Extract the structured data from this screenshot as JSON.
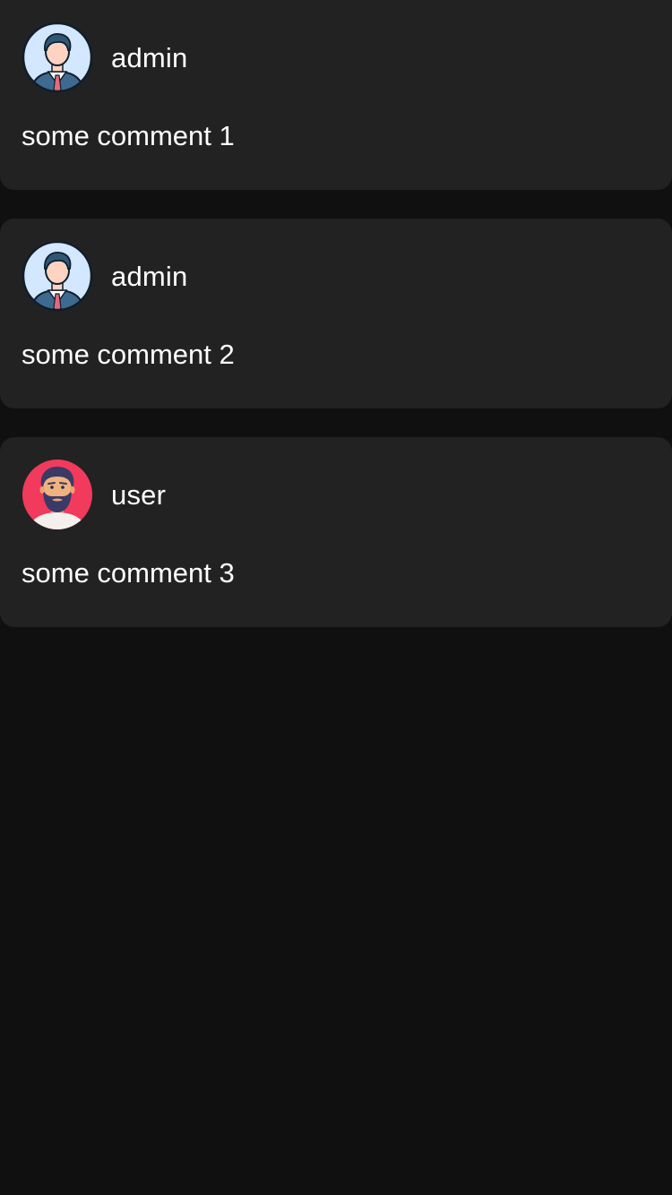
{
  "comments": [
    {
      "author": "admin",
      "avatar_icon": "admin-avatar-icon",
      "text": "some comment 1"
    },
    {
      "author": "admin",
      "avatar_icon": "admin-avatar-icon",
      "text": "some comment 2"
    },
    {
      "author": "user",
      "avatar_icon": "user-avatar-icon",
      "text": "some comment 3"
    }
  ],
  "colors": {
    "background": "#101010",
    "card": "#222222",
    "text": "#ffffff",
    "user_avatar_bg": "#f23a5c",
    "admin_avatar_bg": "#d3e7ff"
  }
}
